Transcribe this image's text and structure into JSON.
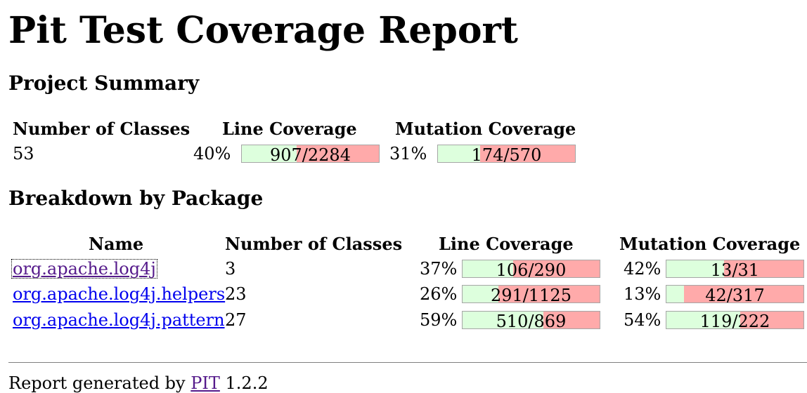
{
  "title": "Pit Test Coverage Report",
  "project_summary": {
    "heading": "Project Summary",
    "headers": {
      "classes": "Number of Classes",
      "line": "Line Coverage",
      "mutation": "Mutation Coverage"
    },
    "classes": "53",
    "line": {
      "percent": "40%",
      "text": "907/2284",
      "fraction": 0.4
    },
    "mutation": {
      "percent": "31%",
      "text": "174/570",
      "fraction": 0.31
    }
  },
  "breakdown": {
    "heading": "Breakdown by Package",
    "headers": {
      "name": "Name",
      "classes": "Number of Classes",
      "line": "Line Coverage",
      "mutation": "Mutation Coverage"
    },
    "rows": [
      {
        "name": "org.apache.log4j",
        "classes": "3",
        "line": {
          "percent": "37%",
          "text": "106/290",
          "fraction": 0.37
        },
        "mutation": {
          "percent": "42%",
          "text": "13/31",
          "fraction": 0.42
        }
      },
      {
        "name": "org.apache.log4j.helpers",
        "classes": "23",
        "line": {
          "percent": "26%",
          "text": "291/1125",
          "fraction": 0.26
        },
        "mutation": {
          "percent": "13%",
          "text": "42/317",
          "fraction": 0.13
        }
      },
      {
        "name": "org.apache.log4j.pattern",
        "classes": "27",
        "line": {
          "percent": "59%",
          "text": "510/869",
          "fraction": 0.59
        },
        "mutation": {
          "percent": "54%",
          "text": "119/222",
          "fraction": 0.54
        }
      }
    ]
  },
  "footer": {
    "prefix": "Report generated by",
    "link": "PIT",
    "version": "1.2.2"
  },
  "colors": {
    "covered": "#ddffdd",
    "uncovered": "#ffaaaa",
    "link": "#0000ee",
    "visited_link": "#551a8b"
  }
}
